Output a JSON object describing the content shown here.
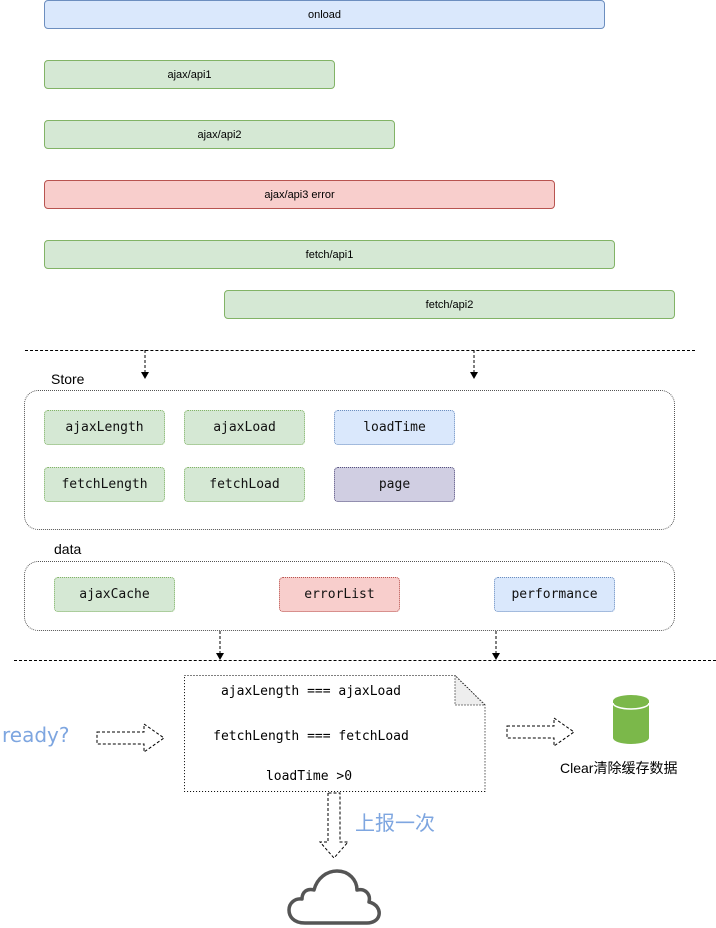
{
  "timeline": {
    "bars": [
      {
        "label": "onload",
        "type": "page-load"
      },
      {
        "label": "ajax/api1",
        "type": "success"
      },
      {
        "label": "ajax/api2",
        "type": "success"
      },
      {
        "label": "ajax/api3 error",
        "type": "error"
      },
      {
        "label": "fetch/api1",
        "type": "success"
      },
      {
        "label": "fetch/api2",
        "type": "success"
      }
    ]
  },
  "store": {
    "title": "Store",
    "items": [
      "ajaxLength",
      "ajaxLoad",
      "loadTime",
      "fetchLength",
      "fetchLoad",
      "page"
    ]
  },
  "data_group": {
    "title": "data",
    "items": [
      "ajaxCache",
      "errorList",
      "performance"
    ]
  },
  "check": {
    "question": "ready?",
    "conditions": [
      "ajaxLength === ajaxLoad",
      "fetchLength === fetchLoad",
      "loadTime >0"
    ],
    "report_label": "上报一次",
    "clear_label": "Clear清除缓存数据"
  },
  "icons": {
    "database": "database-icon",
    "cloud": "cloud-icon"
  },
  "colors": {
    "blue_fill": "#dae8fc",
    "green_fill": "#d5e8d4",
    "red_fill": "#f8cecc",
    "purple_fill": "#d0cee2",
    "accent_text": "#7ea6e0",
    "database_green": "#7bb84a",
    "cloud_gray": "#555555"
  }
}
